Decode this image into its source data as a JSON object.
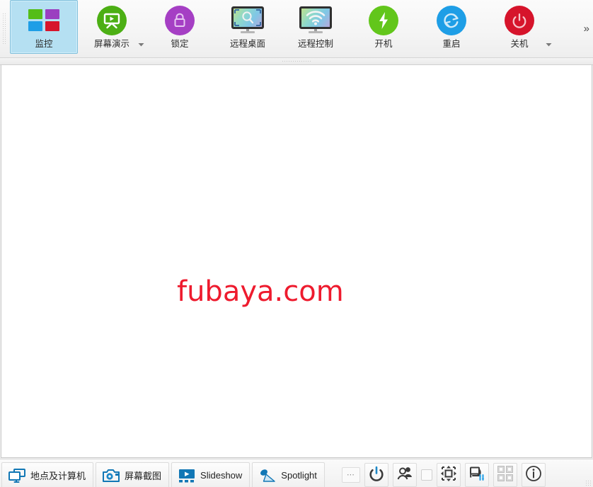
{
  "ribbon": {
    "overflow_label": "»",
    "buttons": [
      {
        "id": "monitor",
        "label": "监控",
        "icon": "tiles-monitor-icon",
        "selected": true,
        "has_caret": false
      },
      {
        "id": "screen-demo",
        "label": "屏幕演示",
        "icon": "presentation-icon",
        "selected": false,
        "has_caret": true,
        "color": "#4caf14"
      },
      {
        "id": "lock",
        "label": "锁定",
        "icon": "lock-icon",
        "selected": false,
        "has_caret": false,
        "color": "#a53fc4"
      },
      {
        "id": "remote-desktop",
        "label": "远程桌面",
        "icon": "monitor-search-icon",
        "selected": false,
        "has_caret": false
      },
      {
        "id": "remote-control",
        "label": "远程控制",
        "icon": "monitor-wifi-icon",
        "selected": false,
        "has_caret": false
      },
      {
        "id": "power-on",
        "label": "开机",
        "icon": "bolt-icon",
        "selected": false,
        "has_caret": false,
        "color": "#62c61b"
      },
      {
        "id": "restart",
        "label": "重启",
        "icon": "refresh-icon",
        "selected": false,
        "has_caret": false,
        "color": "#1e9ee6"
      },
      {
        "id": "shutdown",
        "label": "关机",
        "icon": "power-icon",
        "selected": false,
        "has_caret": true,
        "color": "#d6142b"
      }
    ]
  },
  "canvas": {
    "watermark": "fubaya.com",
    "watermark_color": "#ee1b2e",
    "background_color": "#ffffff"
  },
  "bottom_bar": {
    "tabs": [
      {
        "id": "sites-computers",
        "label": "地点及计算机",
        "icon": "monitors-icon"
      },
      {
        "id": "screenshot",
        "label": "屏幕截图",
        "icon": "camera-icon"
      },
      {
        "id": "slideshow",
        "label": "Slideshow",
        "icon": "slideshow-icon"
      },
      {
        "id": "spotlight",
        "label": "Spotlight",
        "icon": "spotlight-icon"
      }
    ],
    "tools": [
      {
        "id": "more",
        "icon": "ellipsis-icon"
      },
      {
        "id": "power",
        "icon": "power-button-icon"
      },
      {
        "id": "users",
        "icon": "users-icon"
      },
      {
        "id": "toggle",
        "icon": "checkbox-icon"
      },
      {
        "id": "fit-screen",
        "icon": "expand-arrows-icon"
      },
      {
        "id": "transfer",
        "icon": "file-transfer-icon"
      },
      {
        "id": "grid-layout",
        "icon": "grid-layout-icon"
      },
      {
        "id": "info",
        "icon": "info-icon"
      }
    ]
  },
  "theme": {
    "selection_fill": "#b5e0f2",
    "selection_border": "#7fbfdb",
    "ribbon_bg": "#f5f5f5",
    "accent_blue": "#1e88c7"
  }
}
